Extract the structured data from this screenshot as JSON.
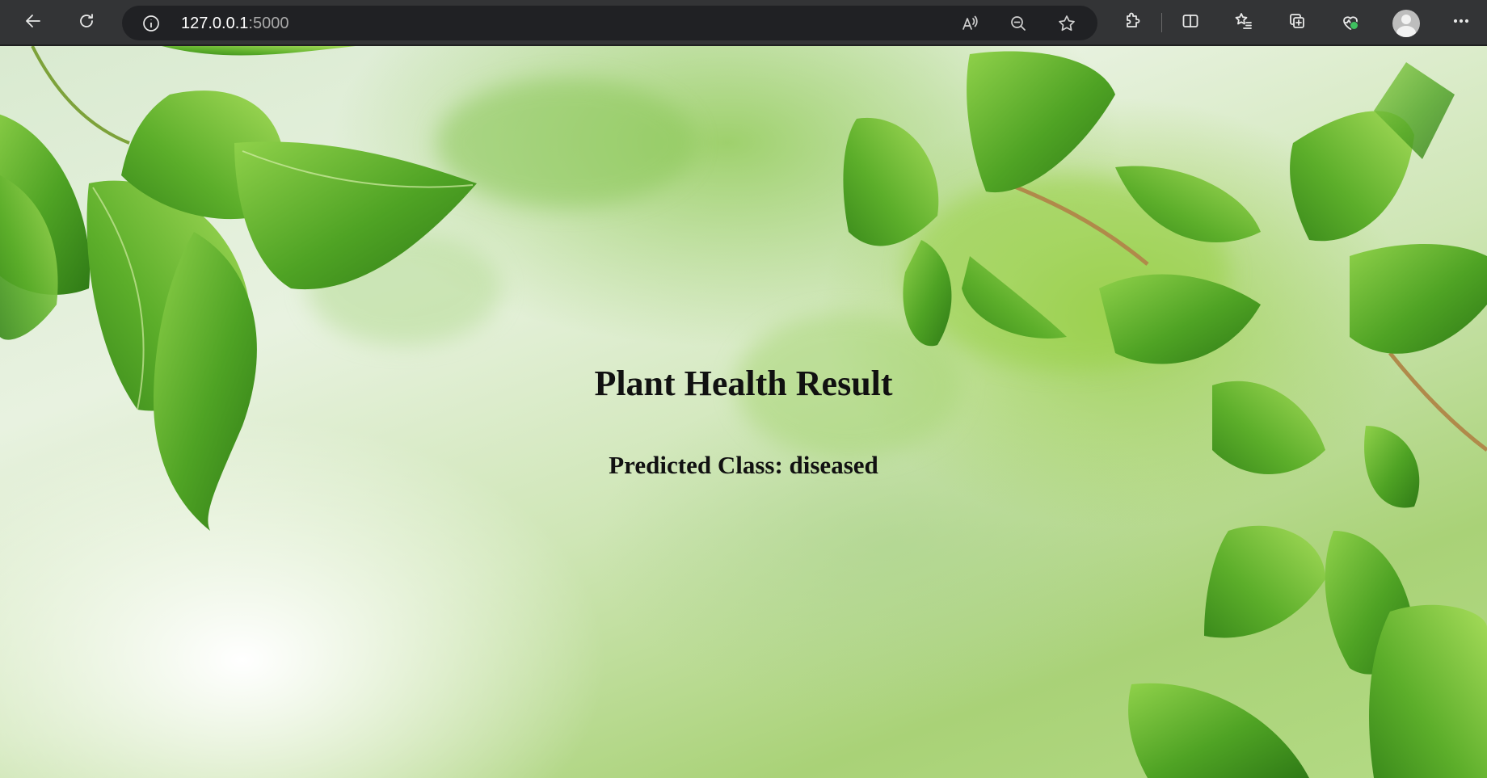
{
  "browser": {
    "url_host": "127.0.0.1",
    "url_port": ":5000",
    "icons": {
      "back": "arrow-left-icon",
      "refresh": "refresh-icon",
      "site_info": "info-icon",
      "read_aloud": "read-aloud-icon",
      "zoom": "zoom-out-icon",
      "favorite": "star-icon",
      "extensions": "puzzle-icon",
      "split": "split-screen-icon",
      "favorites": "favorites-icon",
      "collections": "collections-icon",
      "health": "browser-essentials-icon",
      "profile": "avatar",
      "menu": "more-icon"
    }
  },
  "page": {
    "title": "Plant Health Result",
    "result_label": "Predicted Class: diseased"
  },
  "colors": {
    "toolbar_bg": "#333436",
    "address_bg": "#202124",
    "leaf_green": "#5aa52a",
    "text": "#111111"
  }
}
